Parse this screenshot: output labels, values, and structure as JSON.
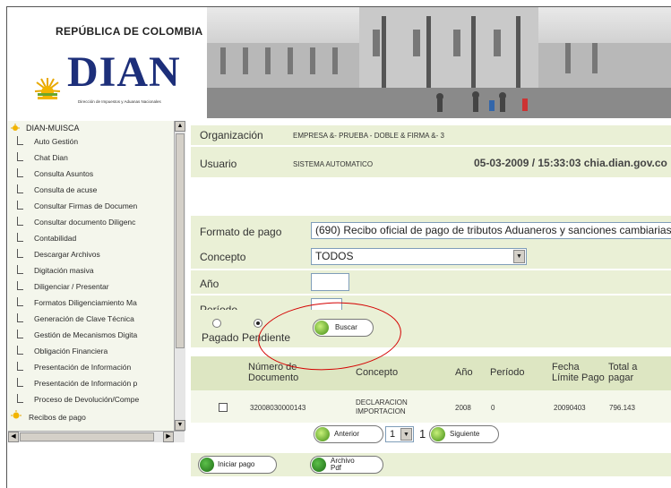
{
  "header": {
    "country": "REPÚBLICA DE COLOMBIA",
    "logo_text": "DIAN",
    "logo_subtitle": "Dirección de Impuestos y Aduanas Nacionales"
  },
  "nav": {
    "root": "DIAN-MUISCA",
    "items": [
      "Auto Gestión",
      "Chat Dian",
      "Consulta Asuntos",
      "Consulta de acuse",
      "Consultar Firmas de Documen",
      "Consultar documento Diligenc",
      "Contabilidad",
      "Descargar Archivos",
      "Digitación masiva",
      "Diligenciar / Presentar",
      "Formatos Diligenciamiento Ma",
      "Generación de Clave Técnica",
      "Gestión de Mecanismos Digita",
      "Obligación Financiera",
      "Presentación de Información",
      "Presentación de Información p",
      "Proceso de Devolución/Compe",
      "Recibos de pago"
    ]
  },
  "info": {
    "org_label": "Organización",
    "org_value": "EMPRESA &- PRUEBA - DOBLE & FIRMA &- 3",
    "user_label": "Usuario",
    "user_value": "SISTEMA AUTOMATICO",
    "datetime": "05-03-2009 / 15:33:03 chia.dian.gov.co"
  },
  "form": {
    "formato_label": "Formato de pago",
    "formato_value": "(690) Recibo oficial de pago de tributos Aduaneros y sanciones cambiarias",
    "concepto_label": "Concepto",
    "concepto_value": "TODOS",
    "anio_label": "Año",
    "periodo_label": "Período",
    "radio_pagado": "Pagado",
    "radio_pendiente": "Pendiente",
    "buscar_label": "Buscar"
  },
  "table": {
    "headers": [
      "Número de Documento",
      "Concepto",
      "Año",
      "Período",
      "Fecha Límite Pago",
      "Total a pagar"
    ],
    "row": {
      "numero": "32008030000143",
      "concepto": "DECLARACION IMPORTACION",
      "anio": "2008",
      "periodo": "0",
      "fecha": "20090403",
      "total": "796.143"
    }
  },
  "pagination": {
    "anterior": "Anterior",
    "page_select": "1",
    "page_total": "1",
    "siguiente": "Siguiente"
  },
  "actions": {
    "iniciar_pago": "Iniciar pago",
    "archivo_pdf": "Archivo Pdf"
  },
  "colors": {
    "row_bg": "#eaf0d6",
    "logo_blue": "#1d2f7a",
    "button_green": "#3d8a12",
    "annotation_red": "#d40000"
  }
}
